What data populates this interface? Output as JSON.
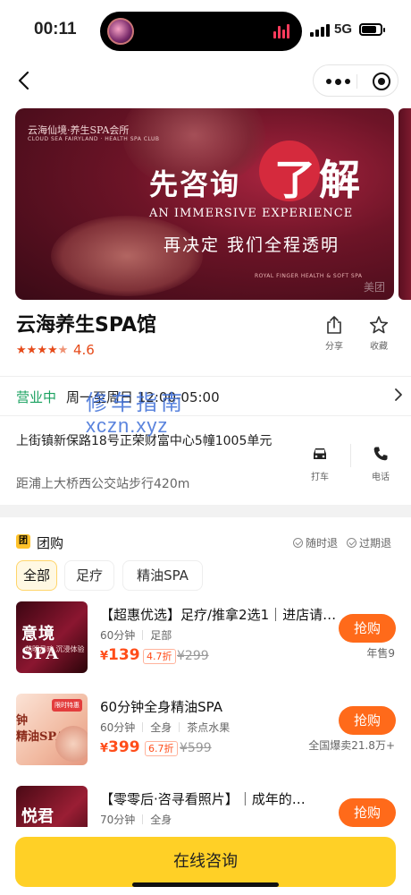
{
  "status_bar": {
    "time": "00:11",
    "network": "5G"
  },
  "banner": {
    "logo_cn": "云海仙境·养生SPA会所",
    "logo_en": "CLOUD SEA FAIRYLAND · HEALTH SPA CLUB",
    "headline_part1": "先咨询",
    "headline_part2": "了解",
    "english": "AN IMMERSIVE EXPERIENCE",
    "subline": "再决定 我们全程透明",
    "footer": "ROYAL FINGER HEALTH & SOFT SPA",
    "watermark": "美团"
  },
  "shop": {
    "name": "云海养生SPA馆",
    "rating": "4.6",
    "share_label": "分享",
    "favorite_label": "收藏",
    "open_status": "营业中",
    "hours": "周一至周日 12:00-05:00",
    "address": "上街镇新保路18号正荣财富中心5幢1005单元",
    "distance": "距浦上大桥西公交站步行420m",
    "taxi_label": "打车",
    "phone_label": "电话"
  },
  "watermark": {
    "line1": "修车指南",
    "line2": "xczn.xyz"
  },
  "deals": {
    "section_badge": "团",
    "section_title": "团购",
    "guarantee1": "随时退",
    "guarantee2": "过期退",
    "filters": [
      "全部",
      "足疗",
      "精油SPA"
    ],
    "items": [
      {
        "img_text": "意境SPA",
        "img_sub": "花明月暗 沉浸体验",
        "title": "【超惠优选】足疗/推拿2选1｜进店请…",
        "tag1": "60分钟",
        "tag2": "足部",
        "price_symbol": "¥",
        "price": "139",
        "discount": "4.7折",
        "original": "¥299",
        "buy_label": "抢购",
        "sold": "年售9"
      },
      {
        "img_text": "钟\n精油SPA",
        "img_badge": "限时特惠",
        "title": "60分钟全身精油SPA",
        "tag1": "60分钟",
        "tag2": "全身",
        "tag3": "茶点水果",
        "price_symbol": "¥",
        "price": "399",
        "discount": "6.7折",
        "original": "¥599",
        "buy_label": "抢购",
        "sold": "全国爆卖21.8万+"
      },
      {
        "img_text": "悦君SPA",
        "title": "【零零后·咨寻看照片】｜成年的…",
        "tag1": "70分钟",
        "tag2": "全身",
        "buy_label": "抢购"
      }
    ]
  },
  "bottom": {
    "consult_label": "在线咨询"
  },
  "colors": {
    "accent": "#ff6a1a",
    "price": "#ff4d1a",
    "open": "#19a15f",
    "cta": "#ffd026"
  }
}
